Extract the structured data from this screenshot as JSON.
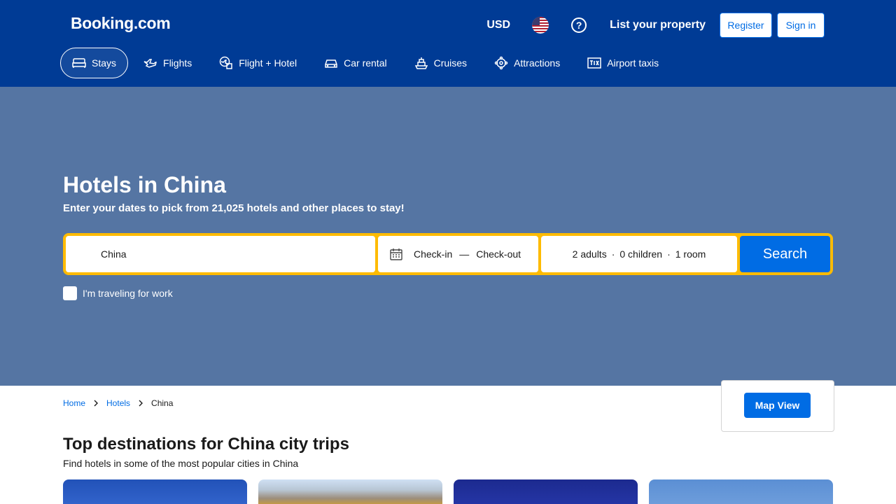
{
  "header": {
    "logo": "Booking.com",
    "currency": "USD",
    "list_property": "List your property",
    "register": "Register",
    "sign_in": "Sign in"
  },
  "nav": {
    "items": [
      {
        "label": "Stays",
        "icon": "bed-icon",
        "active": true
      },
      {
        "label": "Flights",
        "icon": "plane-icon"
      },
      {
        "label": "Flight + Hotel",
        "icon": "flight-hotel-icon"
      },
      {
        "label": "Car rental",
        "icon": "car-icon"
      },
      {
        "label": "Cruises",
        "icon": "ship-icon"
      },
      {
        "label": "Attractions",
        "icon": "attractions-icon"
      },
      {
        "label": "Airport taxis",
        "icon": "taxi-icon"
      }
    ]
  },
  "hero": {
    "title": "Hotels in China",
    "subtitle": "Enter your dates to pick from 21,025 hotels and other places to stay!",
    "destination_value": "China",
    "check_in": "Check-in",
    "check_out": "Check-out",
    "dash": "—",
    "adults": "2 adults",
    "children": "0 children",
    "rooms": "1 room",
    "dot": "·",
    "search": "Search",
    "work_label": "I'm traveling for work"
  },
  "breadcrumb": {
    "home": "Home",
    "hotels": "Hotels",
    "current": "China"
  },
  "map_view": "Map View",
  "section": {
    "title": "Top destinations for China city trips",
    "subtitle": "Find hotels in some of the most popular cities in China"
  },
  "colors": {
    "brand": "#003b95",
    "hero": "#5575a3",
    "accent": "#006ce4",
    "search_border": "#febb02"
  }
}
